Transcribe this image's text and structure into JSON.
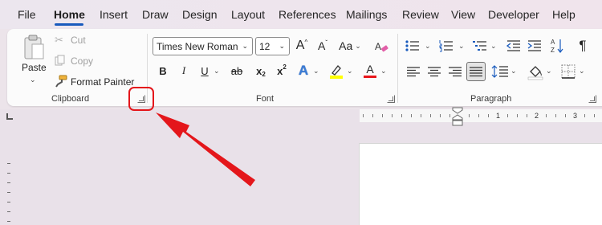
{
  "menu": {
    "tabs": [
      "File",
      "Home",
      "Insert",
      "Draw",
      "Design",
      "Layout",
      "References",
      "Mailings",
      "Review",
      "View",
      "Developer",
      "Help"
    ],
    "active": "Home"
  },
  "clipboard": {
    "paste_label": "Paste",
    "cut_label": "Cut",
    "copy_label": "Copy",
    "format_painter_label": "Format Painter",
    "group_label": "Clipboard"
  },
  "font": {
    "font_name": "Times New Roman",
    "font_size": "12",
    "grow_label": "A",
    "shrink_label": "A",
    "case_label": "Aa",
    "bold_label": "B",
    "italic_label": "I",
    "underline_label": "U",
    "strike_label": "ab",
    "subscript_label": "x",
    "superscript_label": "x",
    "text_effects_label": "A",
    "highlight_color": "#ffff00",
    "font_color_label": "A",
    "font_color": "#e8161b",
    "group_label": "Font"
  },
  "paragraph": {
    "group_label": "Paragraph",
    "show_marks_label": "¶"
  },
  "ruler": {
    "numbers": [
      "1",
      "2",
      "3"
    ]
  },
  "colors": {
    "accent": "#185abd",
    "annotation_red": "#e4161b"
  }
}
